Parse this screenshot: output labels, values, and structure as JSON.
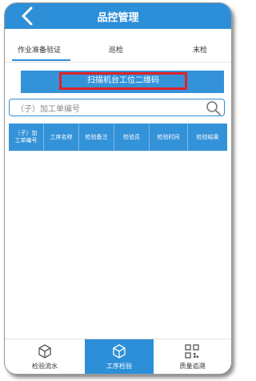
{
  "header": {
    "title": "品控管理",
    "back_icon": "back-arrow-icon"
  },
  "tabs": [
    {
      "label": "作业准备验证",
      "active": true
    },
    {
      "label": "巡检",
      "active": false
    },
    {
      "label": "末检",
      "active": false
    }
  ],
  "scan_button": {
    "label": "扫描机台工位二维码",
    "highlight_color": "#e02127"
  },
  "search": {
    "placeholder": "（子）加工单编号",
    "icon": "search-icon"
  },
  "table": {
    "columns": [
      "（子）加\n工单编号",
      "工序名称",
      "检验备注",
      "检验员",
      "检验时间",
      "检验结果"
    ],
    "rows": []
  },
  "bottom_nav": [
    {
      "label": "检验流水",
      "icon": "cube-icon",
      "active": false
    },
    {
      "label": "工序检验",
      "icon": "cube-icon",
      "active": true
    },
    {
      "label": "质量追溯",
      "icon": "qr-code-icon",
      "active": false
    }
  ],
  "colors": {
    "accent": "#2d8fd8",
    "header_bg": "#3492d9",
    "highlight": "#e02127"
  }
}
